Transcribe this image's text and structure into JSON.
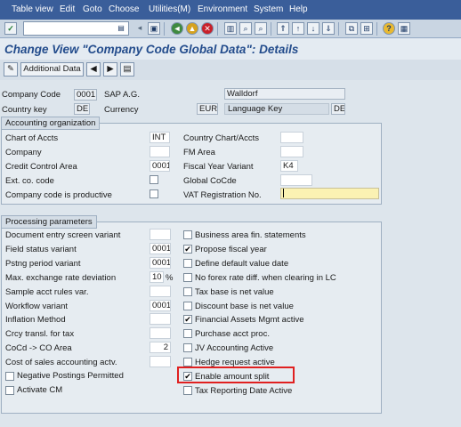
{
  "menubar": {
    "items": [
      "Table view",
      "Edit",
      "Goto",
      "Choose",
      "Utilities(M)",
      "Environment",
      "System",
      "Help"
    ]
  },
  "toolbar": {
    "command_field_value": ""
  },
  "title": "Change View \"Company Code Global Data\": Details",
  "app_toolbar": {
    "additional_data_label": "Additional Data"
  },
  "header": {
    "company_code_label": "Company Code",
    "company_code_value": "0001",
    "company_name": "SAP A.G.",
    "city": "Walldorf",
    "country_key_label": "Country key",
    "country_key_value": "DE",
    "currency_label": "Currency",
    "currency_value": "EUR",
    "language_key_label": "Language Key",
    "language_key_value": "DE"
  },
  "accounting": {
    "title": "Accounting organization",
    "chart_of_accts_label": "Chart of Accts",
    "chart_of_accts_value": "INT",
    "country_chart_label": "Country Chart/Accts",
    "country_chart_value": "",
    "company_label": "Company",
    "company_value": "",
    "fm_area_label": "FM Area",
    "fm_area_value": "",
    "credit_control_label": "Credit Control Area",
    "credit_control_value": "0001",
    "fiscal_year_variant_label": "Fiscal Year Variant",
    "fiscal_year_variant_value": "K4",
    "ext_co_code_label": "Ext. co. code",
    "global_cocde_label": "Global CoCde",
    "global_cocde_value": "",
    "productive_label": "Company code is productive",
    "vat_label": "VAT Registration No.",
    "vat_value": ""
  },
  "processing": {
    "title": "Processing parameters",
    "left": [
      {
        "label": "Document entry screen variant",
        "value": ""
      },
      {
        "label": "Field status variant",
        "value": "0001"
      },
      {
        "label": "Pstng period variant",
        "value": "0001"
      },
      {
        "label": "Max. exchange rate deviation",
        "value": "10",
        "unit": "%"
      },
      {
        "label": "Sample acct rules var.",
        "value": ""
      },
      {
        "label": "Workflow variant",
        "value": "0001"
      },
      {
        "label": "Inflation Method",
        "value": ""
      },
      {
        "label": "Crcy transl. for tax",
        "value": ""
      },
      {
        "label": "CoCd -> CO Area",
        "value": "2"
      },
      {
        "label": "Cost of sales accounting actv.",
        "value": ""
      }
    ],
    "neg_postings_label": "Negative Postings Permitted",
    "activate_cm_label": "Activate CM",
    "right": [
      {
        "label": "Business area fin. statements",
        "checked": false
      },
      {
        "label": "Propose fiscal year",
        "checked": true
      },
      {
        "label": "Define default value date",
        "checked": false
      },
      {
        "label": "No forex rate diff. when clearing in LC",
        "checked": false
      },
      {
        "label": "Tax base is net value",
        "checked": false
      },
      {
        "label": "Discount base is net value",
        "checked": false
      },
      {
        "label": "Financial Assets Mgmt active",
        "checked": true
      },
      {
        "label": "Purchase acct proc.",
        "checked": false
      },
      {
        "label": "JV Accounting Active",
        "checked": false
      },
      {
        "label": "Hedge request active",
        "checked": false
      },
      {
        "label": "Enable amount split",
        "checked": true
      },
      {
        "label": "Tax Reporting Date Active",
        "checked": false
      }
    ],
    "check_mark": "✔"
  },
  "colors": {
    "menubar": "#3a5e9a",
    "title": "#234c8c",
    "highlight": "#e02020"
  }
}
